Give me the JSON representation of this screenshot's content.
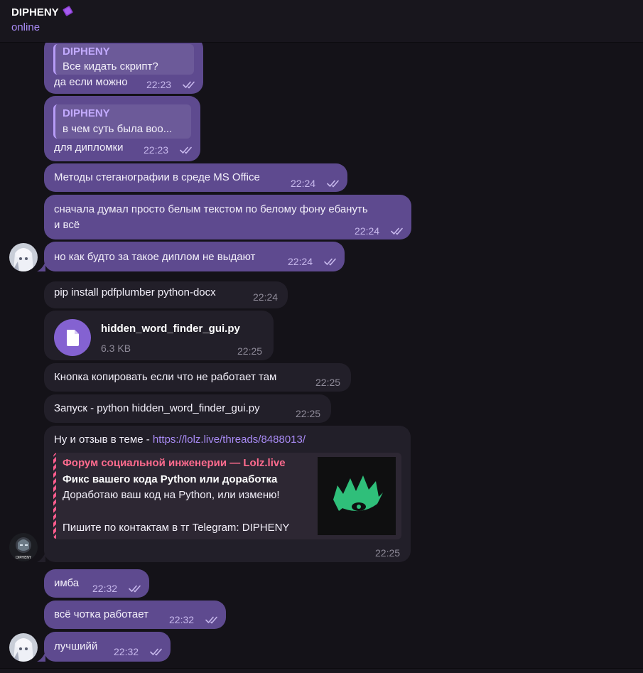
{
  "header": {
    "title": "DIPHENY",
    "status": "online"
  },
  "icons": {
    "title_emoji": "purple-card-icon",
    "read_checks": "double-check-icon",
    "file": "document-icon"
  },
  "colors": {
    "outgoing_bubble": "#5e4a8f",
    "incoming_bubble": "#221f29",
    "accent": "#a98bf5",
    "link": "#a98bf5",
    "preview_site": "#ff6b8e"
  },
  "messages": [
    {
      "reply_name": "DIPHENY",
      "reply_text": "Все кидать скрипт?",
      "text": "да если можно",
      "time": "22:23"
    },
    {
      "reply_name": "DIPHENY",
      "reply_text": "в чем суть была воо...",
      "text": "для дипломки",
      "time": "22:23"
    },
    {
      "text": "Методы стеганографии в среде MS Office",
      "time": "22:24"
    },
    {
      "text_line1": "сначала думал просто белым текстом по белому фону ебануть",
      "text_line2": "и всё",
      "time": "22:24"
    },
    {
      "text": "но как будто за такое диплом не выдают",
      "time": "22:24"
    },
    {
      "text": "pip install pdfplumber python-docx",
      "time": "22:24"
    },
    {
      "file_name": "hidden_word_finder_gui.py",
      "file_size": "6.3 KB",
      "time": "22:25"
    },
    {
      "text": "Кнопка копировать если что не работает там",
      "time": "22:25"
    },
    {
      "text": "Запуск - python hidden_word_finder_gui.py",
      "time": "22:25"
    },
    {
      "text": "Ну и отзыв в теме - ",
      "link": "https://lolz.live/threads/8488013/",
      "preview_site": "Форум социальной инженерии —  Lolz.live",
      "preview_title": "Фикс вашего кода Python или доработка",
      "preview_desc1": "Доработаю ваш код на Python, или изменю!",
      "preview_desc2": "Пишите по контактам в тг Telegram: DIPHENY",
      "time": "22:25"
    },
    {
      "text": "имба",
      "time": "22:32"
    },
    {
      "text": "всё чотка работает",
      "time": "22:32"
    },
    {
      "text": "лучшийй",
      "time": "22:32"
    }
  ],
  "avatars": {
    "dipheny_label": "DIPHENY"
  }
}
